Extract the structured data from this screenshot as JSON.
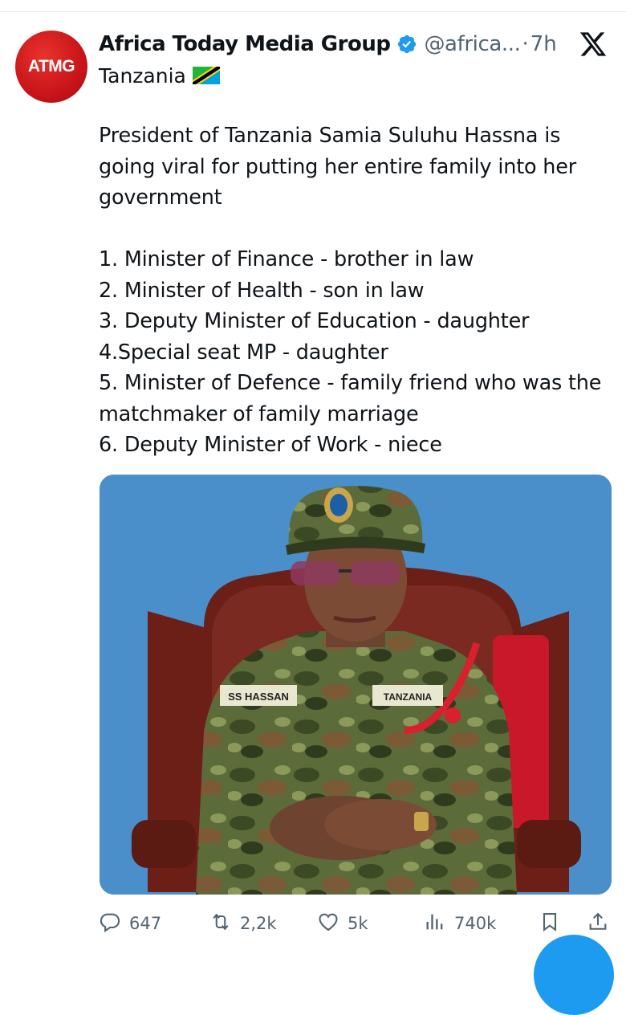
{
  "author": {
    "avatar_text": "ATMG",
    "display_name": "Africa Today Media Group",
    "handle": "@africa...",
    "separator": "·",
    "time": "7h",
    "location": "Tanzania",
    "verified_color": "#1d9bf0"
  },
  "tweet": {
    "intro": "President of Tanzania Samia Suluhu Hassna is going viral for putting her entire family into her government",
    "items": [
      "1. Minister of Finance - brother in law",
      "2. Minister of Health - son in law",
      "3. Deputy Minister of Education - daughter",
      "4.Special seat MP - daughter",
      "5. Minister of Defence - family friend who was the matchmaker of family marriage",
      "6. Deputy Minister of Work - niece"
    ]
  },
  "media": {
    "name_tape": "SS HASSAN",
    "country_tape": "TANZANIA",
    "background_color": "#4a8fc9"
  },
  "actions": {
    "replies": "647",
    "reposts": "2,2k",
    "likes": "5k",
    "views": "740k"
  },
  "icons": [
    "x-logo-icon",
    "verified-badge-icon",
    "tanzania-flag-icon",
    "reply-icon",
    "repost-icon",
    "like-icon",
    "views-icon",
    "bookmark-icon",
    "share-icon"
  ]
}
